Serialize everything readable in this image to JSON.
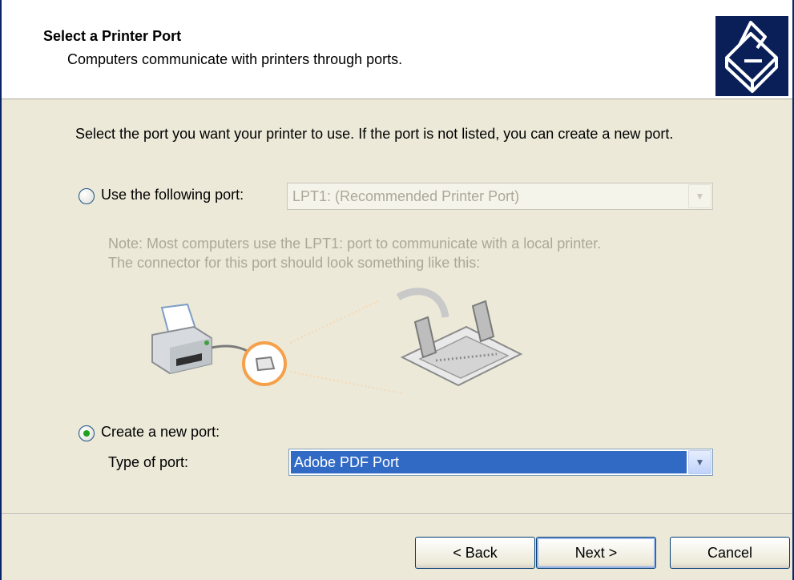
{
  "header": {
    "title": "Select a Printer Port",
    "subtitle": "Computers communicate with printers through ports."
  },
  "instructions": "Select the port you want your printer to use.  If the port is not listed, you can create a new port.",
  "use_port": {
    "label": "Use the following port:",
    "selected": false,
    "value": "LPT1: (Recommended Printer Port)"
  },
  "note": {
    "line1": "Note: Most computers use the LPT1: port to communicate with a local printer.",
    "line2": "The connector for this port should look something like this:"
  },
  "create_port": {
    "label": "Create a new port:",
    "selected": true,
    "type_label": "Type of port:",
    "value": "Adobe PDF Port"
  },
  "buttons": {
    "back": "< Back",
    "next": "Next >",
    "cancel": "Cancel"
  },
  "colors": {
    "dialog_bg": "#ece9d8",
    "selection": "#316ac5",
    "connector_highlight": "#f5a04a"
  },
  "icons": {
    "header": "printer-wizard-icon",
    "illustration": "printer-connector-illustration"
  }
}
